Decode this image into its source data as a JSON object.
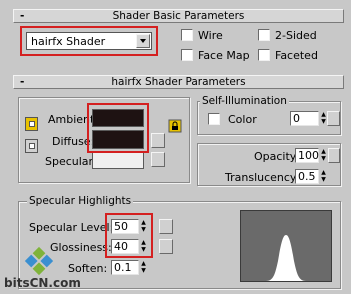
{
  "basic": {
    "header": "Shader Basic Parameters",
    "shader_select": "hairfx Shader",
    "options": [
      {
        "label": "Wire",
        "checked": false
      },
      {
        "label": "2-Sided",
        "checked": false
      },
      {
        "label": "Face Map",
        "checked": false
      },
      {
        "label": "Faceted",
        "checked": false
      }
    ]
  },
  "hairfx": {
    "header": "hairfx Shader Parameters",
    "ambient_label": "Ambient:",
    "diffuse_label": "Diffuse:",
    "specular_label": "Specular:",
    "ambient_color": "#1e1212",
    "diffuse_color": "#1e1212",
    "specular_color": "#f0f0f0",
    "self_illum": {
      "title": "Self-Illumination",
      "color_label": "Color",
      "value": "0"
    },
    "opacity": {
      "label": "Opacity:",
      "value": "100"
    },
    "translucency": {
      "label": "Translucency:",
      "value": "0.5"
    }
  },
  "specular_highlights": {
    "title": "Specular Highlights",
    "level": {
      "label": "Specular Level:",
      "value": "50"
    },
    "glossiness": {
      "label": "Glossiness:",
      "value": "40"
    },
    "soften": {
      "label": "Soften:",
      "value": "0.1"
    },
    "curve_bg": "#6a6a6a",
    "curve_fill": "#ffffff"
  },
  "watermark": "bitsCN.com",
  "icons": {
    "dropdown": "chevron-down-icon",
    "lock": "lock-icon",
    "map_link": "map-link-icon"
  },
  "highlight_color": "#d42020"
}
